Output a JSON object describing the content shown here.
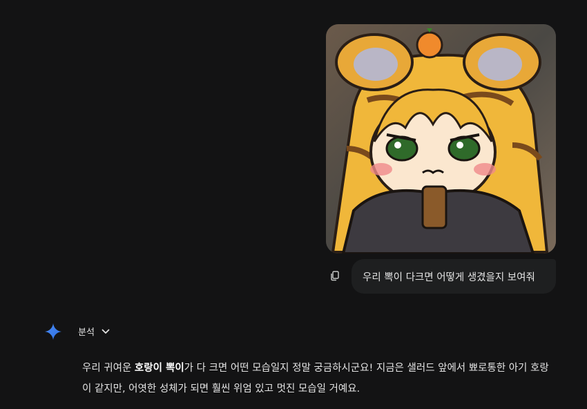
{
  "user_message": {
    "text": "우리 뽁이 다크면 어떻게 생겼을지 보여줘",
    "image_name": "tiger-chibi-character-image",
    "copy_icon": "copy-icon"
  },
  "assistant": {
    "icon": "gemini-sparkle-icon",
    "analysis_label": "분석",
    "analysis_icon": "chevron-down-icon",
    "response_part1": "우리 귀여운 ",
    "response_bold": "호랑이 뽁이",
    "response_part2": "가 다 크면 어떤 모습일지 정말 궁금하시군요! 지금은 샐러드 앞에서 뾰로통한 아기 호랑이 같지만, 어엿한 성체가 되면 훨씬 위엄 있고 멋진 모습일 거예요."
  },
  "colors": {
    "background": "#131314",
    "bubble": "#1e1f20",
    "text": "#e3e3e3",
    "accent": "#4285f4"
  }
}
